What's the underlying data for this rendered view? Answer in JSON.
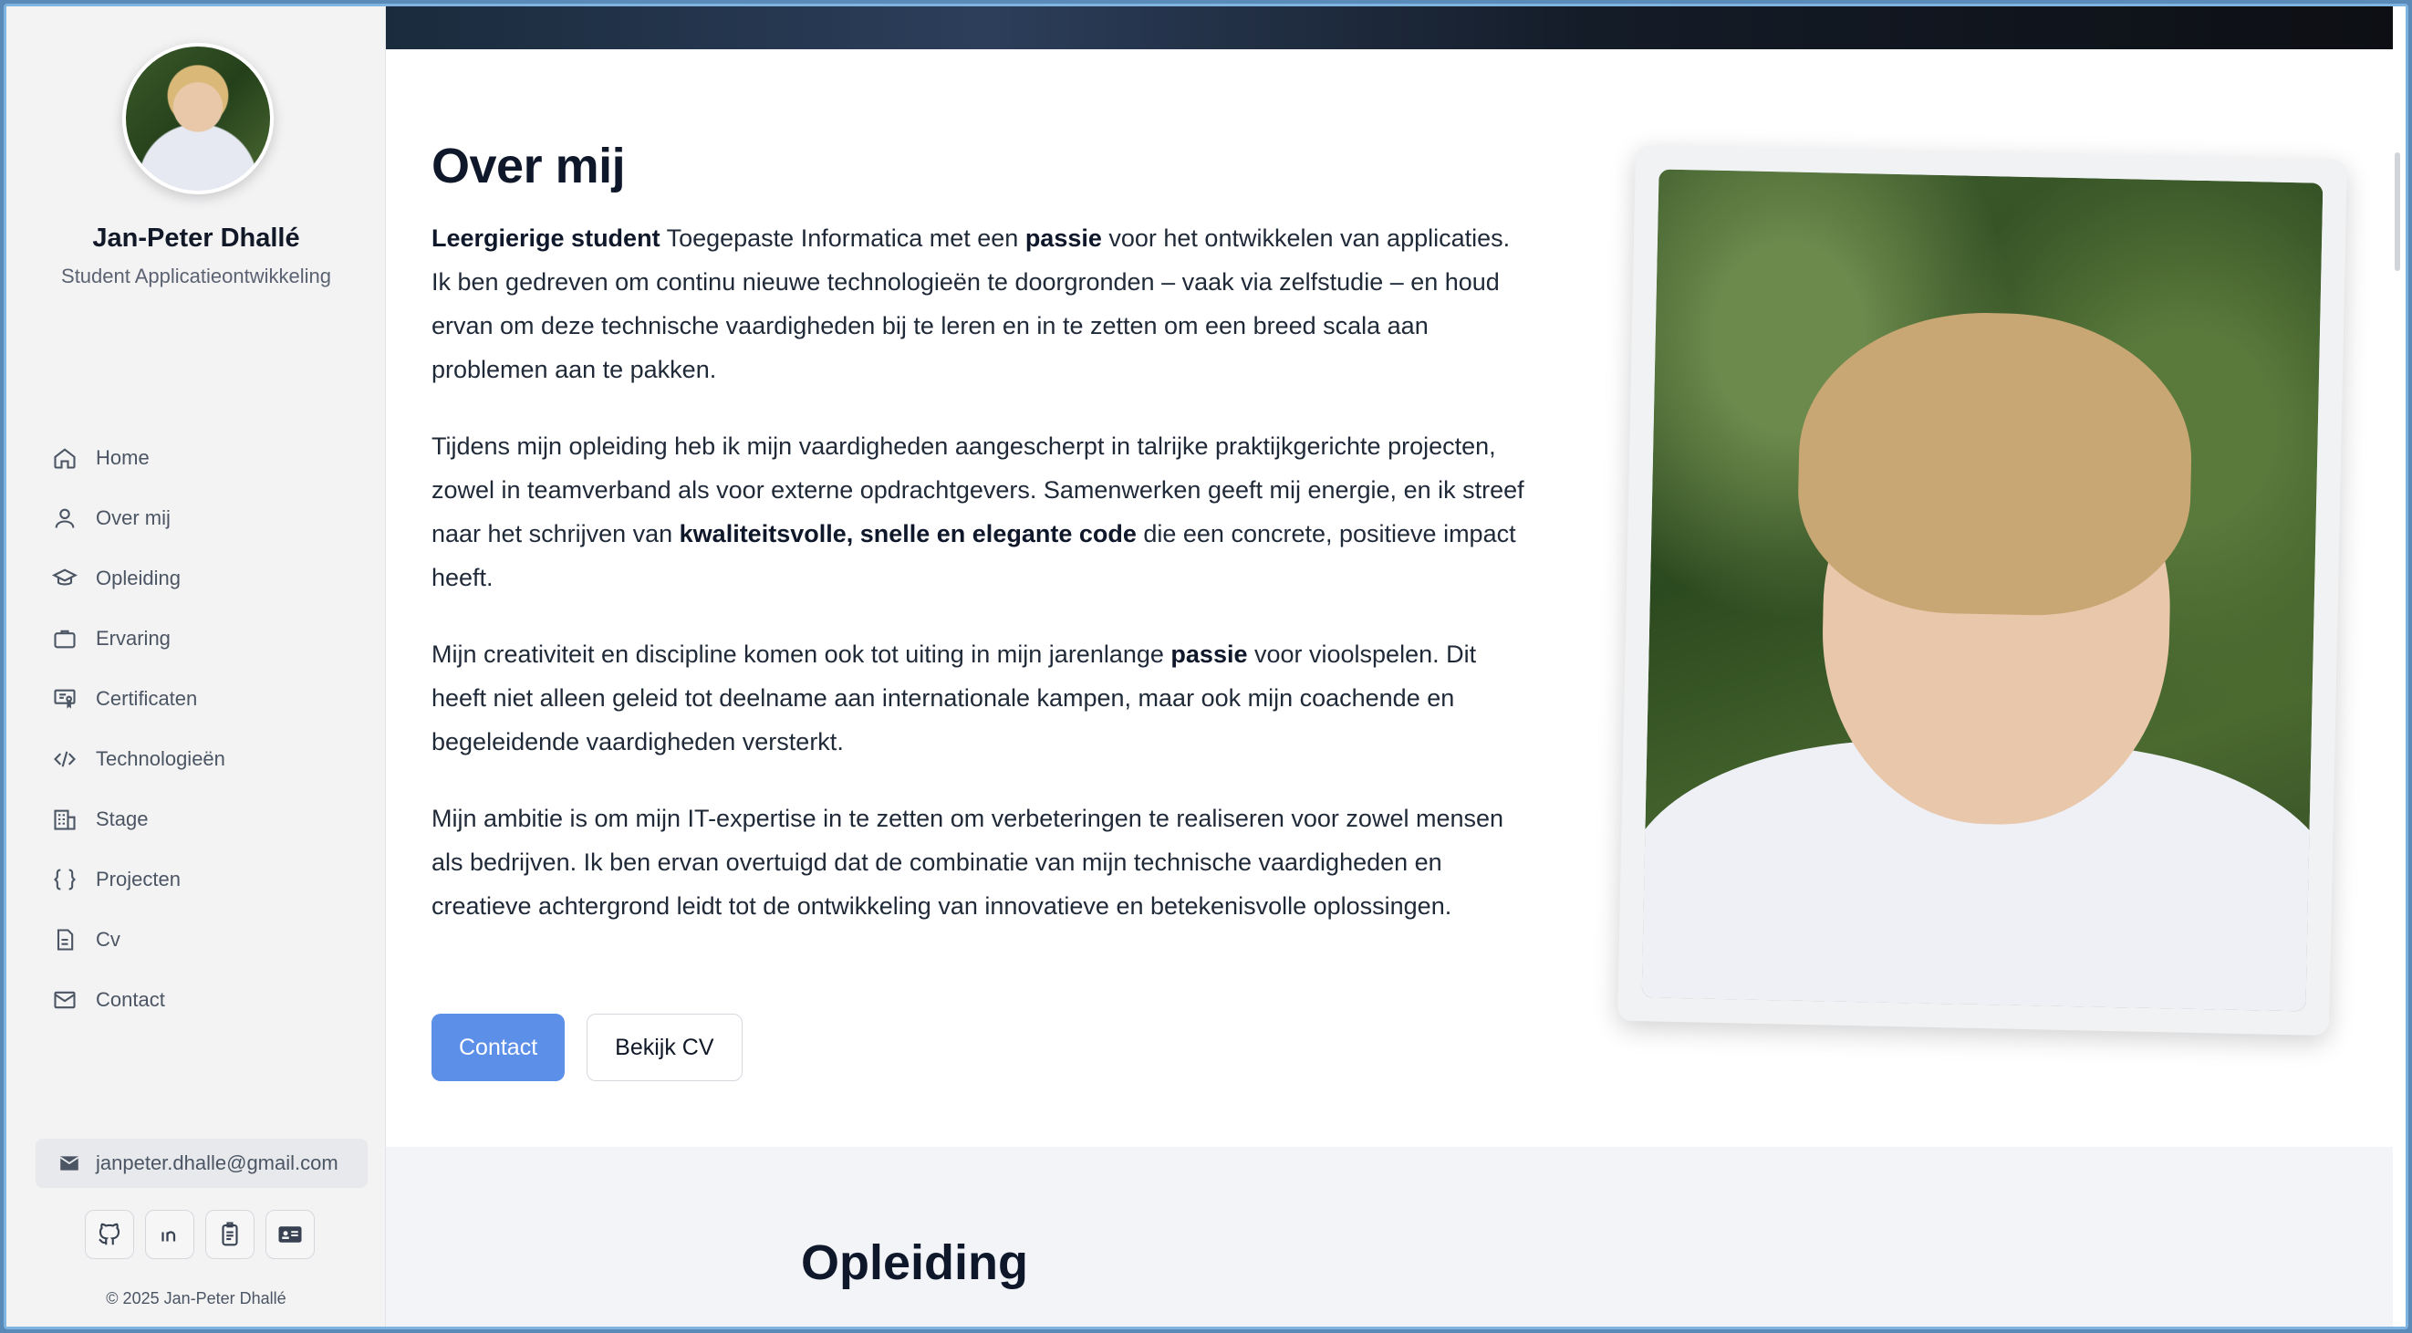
{
  "profile": {
    "name": "Jan-Peter Dhallé",
    "role": "Student Applicatieontwikkeling"
  },
  "nav": [
    {
      "label": "Home",
      "icon": "home-icon"
    },
    {
      "label": "Over mij",
      "icon": "user-icon"
    },
    {
      "label": "Opleiding",
      "icon": "graduation-cap-icon"
    },
    {
      "label": "Ervaring",
      "icon": "briefcase-icon"
    },
    {
      "label": "Certificaten",
      "icon": "certificate-icon"
    },
    {
      "label": "Technologieën",
      "icon": "code-icon"
    },
    {
      "label": "Stage",
      "icon": "building-icon"
    },
    {
      "label": "Projecten",
      "icon": "braces-icon"
    },
    {
      "label": "Cv",
      "icon": "document-icon"
    },
    {
      "label": "Contact",
      "icon": "mail-icon"
    }
  ],
  "sidebar_footer": {
    "email": "janpeter.dhalle@gmail.com",
    "socials": [
      "github-icon",
      "linkedin-icon",
      "badge-icon",
      "id-card-icon"
    ],
    "copyright": "© 2025 Jan-Peter Dhallé"
  },
  "about": {
    "title": "Over mij",
    "p1": {
      "b1": "Leergierige student",
      "t1": " Toegepaste Informatica met een ",
      "b2": "passie",
      "t2": " voor het ontwikkelen van applicaties. Ik ben gedreven om continu nieuwe technologieën te doorgronden – vaak via zelfstudie – en houd ervan om deze technische vaardigheden bij te leren en in te zetten om een breed scala aan problemen aan te pakken."
    },
    "p2": {
      "t1": "Tijdens mijn opleiding heb ik mijn vaardigheden aangescherpt in talrijke praktijkgerichte projecten, zowel in teamverband als voor externe opdrachtgevers. Samenwerken geeft mij energie, en ik streef naar het schrijven van ",
      "b1": "kwaliteitsvolle, snelle en elegante code",
      "t2": " die een concrete, positieve impact heeft."
    },
    "p3": {
      "t1": "Mijn creativiteit en discipline komen ook tot uiting in mijn jarenlange ",
      "b1": "passie",
      "t2": " voor vioolspelen. Dit heeft niet alleen geleid tot deelname aan internationale kampen, maar ook mijn coachende en begeleidende vaardigheden versterkt."
    },
    "p4": "Mijn ambitie is om mijn IT-expertise in te zetten om verbeteringen te realiseren voor zowel mensen als bedrijven. Ik ben ervan overtuigd dat de combinatie van mijn technische vaardigheden en creatieve achtergrond leidt tot de ontwikkeling van innovatieve en betekenisvolle oplossingen.",
    "contact_button": "Contact",
    "cv_button": "Bekijk CV"
  },
  "next_section": {
    "title": "Opleiding"
  },
  "colors": {
    "accent": "#5c8fe8",
    "sidebar_bg": "#f3f3f4",
    "section_bg": "#f2f4f8"
  }
}
